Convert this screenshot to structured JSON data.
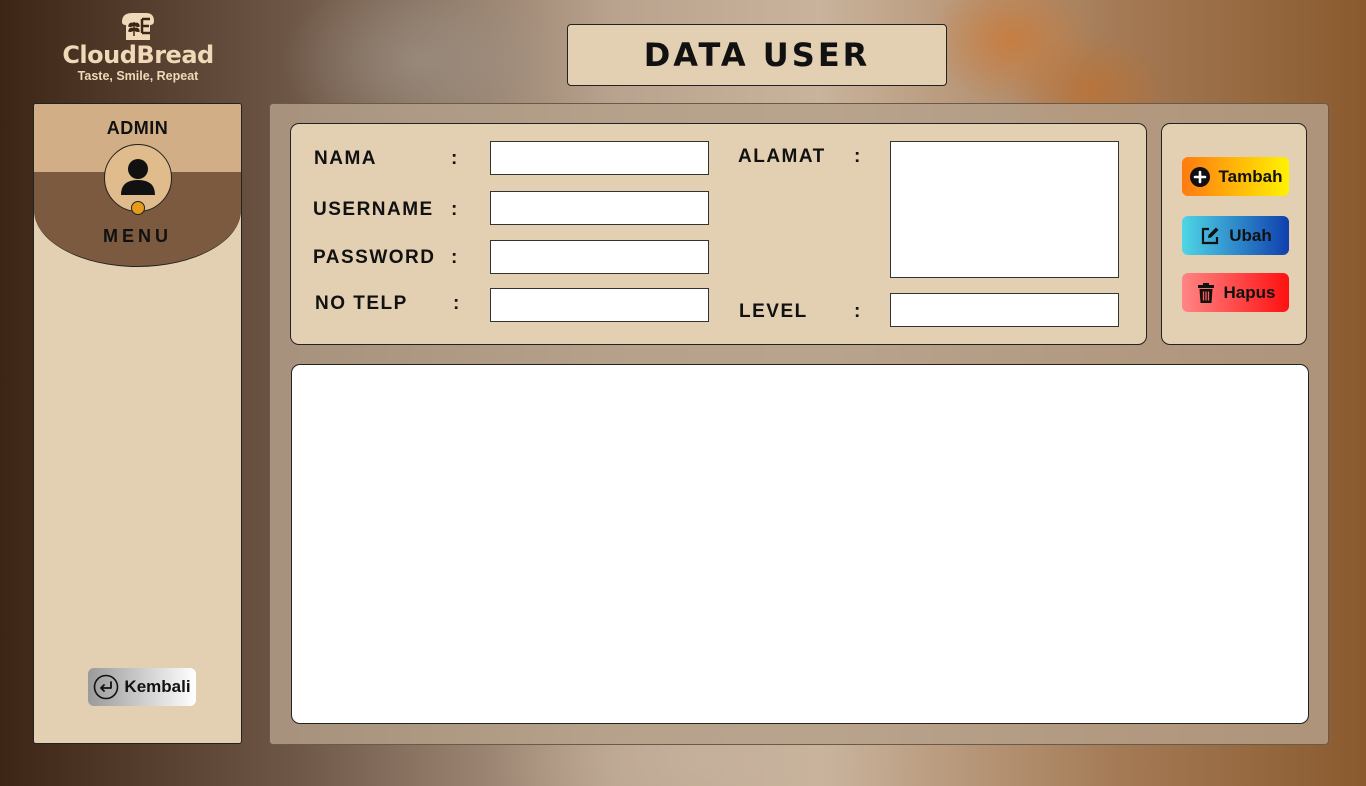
{
  "brand": {
    "name": "CloudBread",
    "tagline": "Taste, Smile, Repeat"
  },
  "page_title": "DATA USER",
  "sidebar": {
    "role_label": "ADMIN",
    "menu_label": "MENU",
    "back_button": "Kembali"
  },
  "form": {
    "nama_label": "NAMA",
    "username_label": "USERNAME",
    "password_label": "PASSWORD",
    "notelp_label": "NO TELP",
    "alamat_label": "ALAMAT",
    "level_label": "LEVEL",
    "colon": ":",
    "nama_value": "",
    "username_value": "",
    "password_value": "",
    "notelp_value": "",
    "alamat_value": "",
    "level_value": ""
  },
  "actions": {
    "tambah": "Tambah",
    "ubah": "Ubah",
    "hapus": "Hapus"
  },
  "colors": {
    "panel_beige": "#e3cfb1",
    "sidebar_brown": "#7b5a40",
    "tambah_gradient": [
      "#ff7a12",
      "#fff200"
    ],
    "ubah_gradient": [
      "#4fd6e6",
      "#0f3fae"
    ],
    "hapus_gradient": [
      "#ff8585",
      "#ff1010"
    ]
  }
}
